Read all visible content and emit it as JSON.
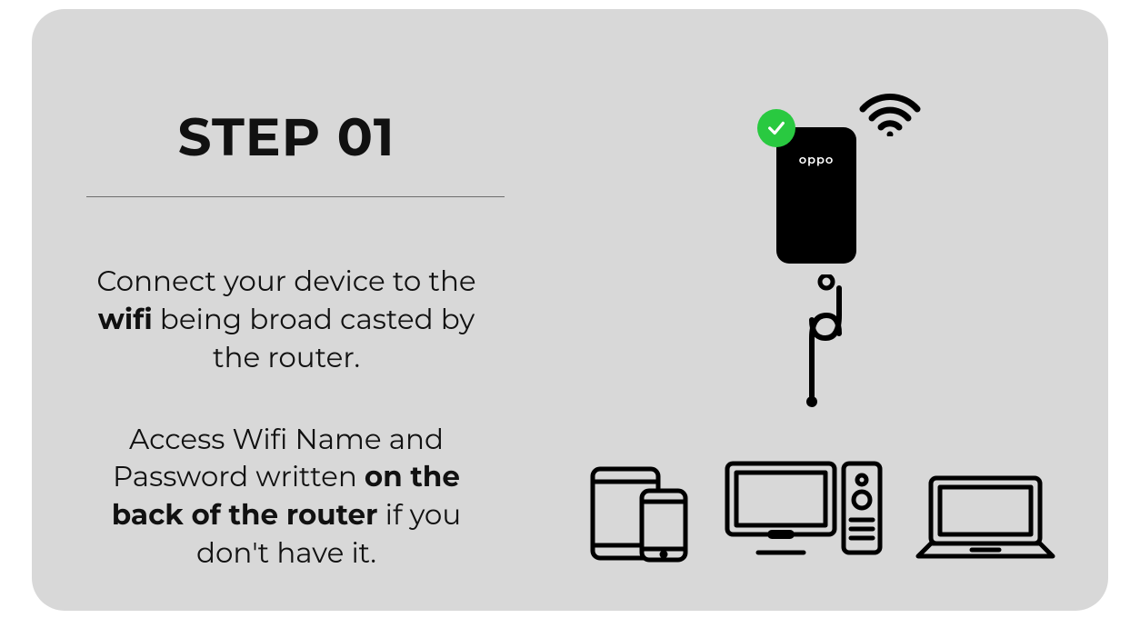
{
  "step": {
    "title": "STEP 01",
    "para1_pre": "Connect your device to the ",
    "para1_bold": "wifi",
    "para1_post": " being broad casted by the router.",
    "para2_pre": "Access Wifi Name and Password written ",
    "para2_bold": "on the back of the router",
    "para2_post": " if you don't have it."
  },
  "phone_brand": "oppo"
}
